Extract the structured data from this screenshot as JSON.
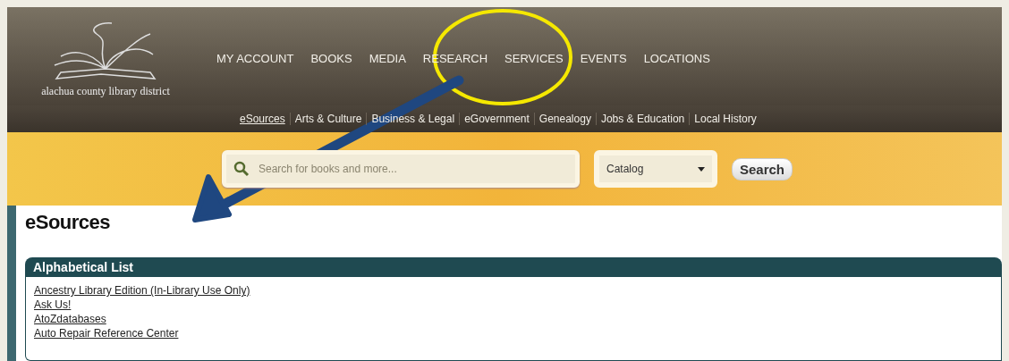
{
  "logo": {
    "text": "alachua county library district"
  },
  "main_nav": [
    {
      "label": "MY ACCOUNT"
    },
    {
      "label": "BOOKS"
    },
    {
      "label": "MEDIA"
    },
    {
      "label": "RESEARCH"
    },
    {
      "label": "SERVICES"
    },
    {
      "label": "EVENTS"
    },
    {
      "label": "LOCATIONS"
    }
  ],
  "sub_nav": [
    {
      "label": "eSources",
      "selected": true
    },
    {
      "label": "Arts & Culture",
      "selected": false
    },
    {
      "label": "Business & Legal",
      "selected": false
    },
    {
      "label": "eGovernment",
      "selected": false
    },
    {
      "label": "Genealogy",
      "selected": false
    },
    {
      "label": "Jobs & Education",
      "selected": false
    },
    {
      "label": "Local History",
      "selected": false
    }
  ],
  "search": {
    "placeholder": "Search for books and more...",
    "scope": "Catalog",
    "button": "Search"
  },
  "page_title": "eSources",
  "section": {
    "title": "Alphabetical List",
    "links": [
      "Ancestry Library Edition (In-Library Use Only)",
      "Ask Us!",
      "AtoZdatabases",
      "Auto Repair Reference Center"
    ]
  }
}
